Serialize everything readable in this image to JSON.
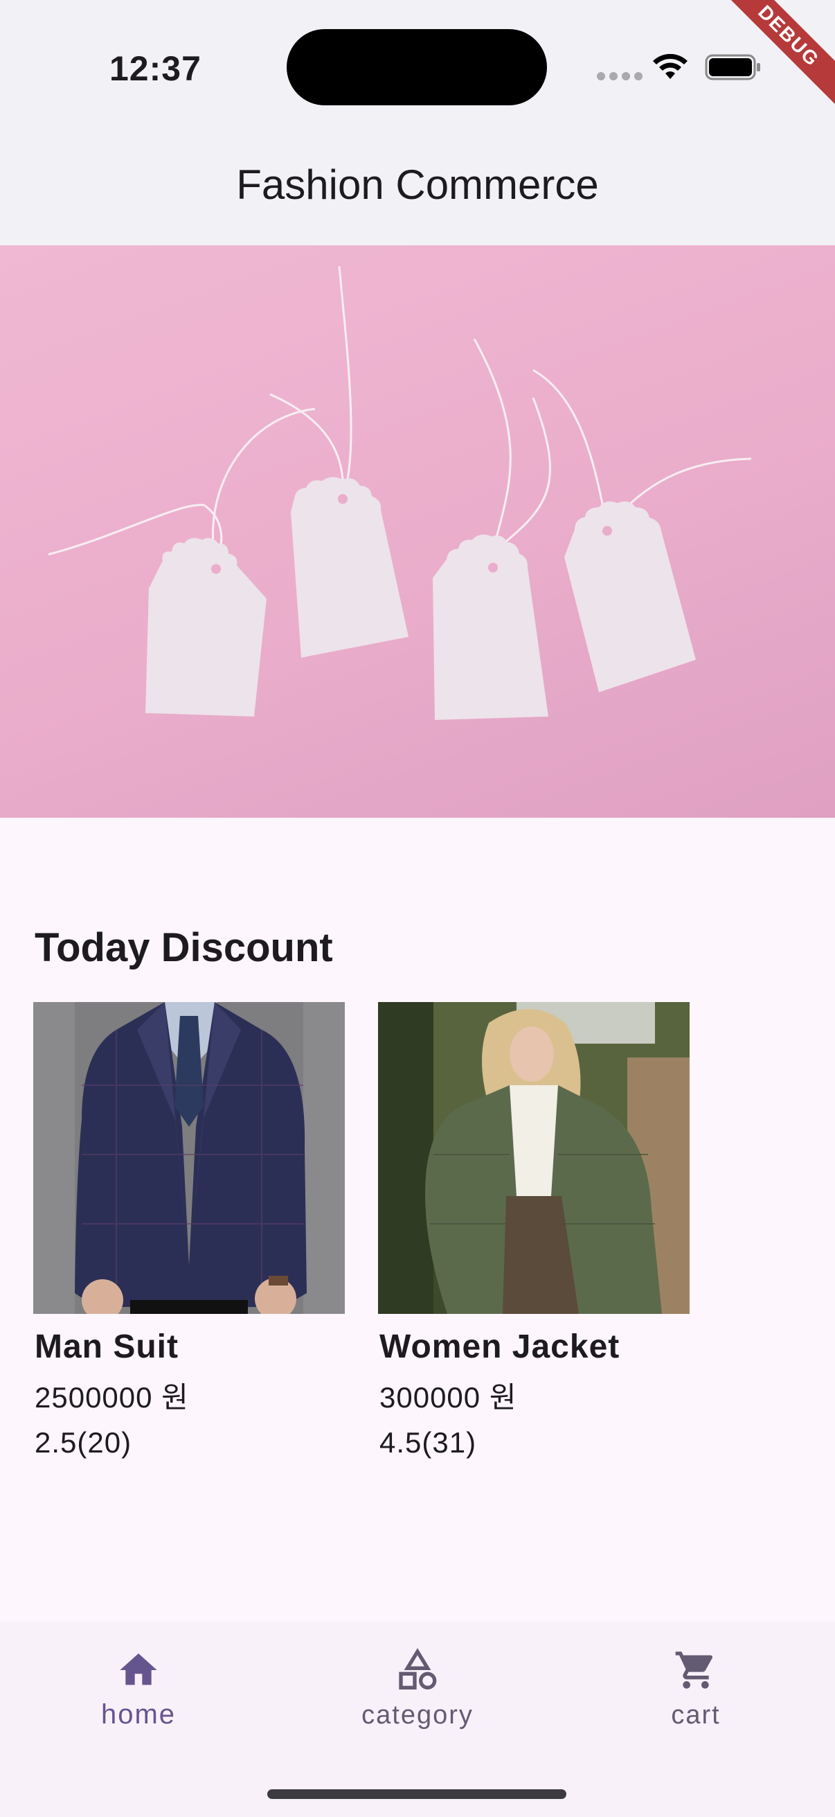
{
  "status_bar": {
    "time": "12:37",
    "debug_label": "DEBUG"
  },
  "app_bar": {
    "title": "Fashion Commerce"
  },
  "banner": {
    "description_icon": "price-tags-banner"
  },
  "today_discount": {
    "title": "Today Discount",
    "products": [
      {
        "name": "Man Suit",
        "price": "2500000 원",
        "rating": "2.5(20)"
      },
      {
        "name": "Women Jacket",
        "price": "300000 원",
        "rating": "4.5(31)"
      }
    ]
  },
  "bottom_nav": {
    "items": [
      {
        "label": "home",
        "icon": "home-icon",
        "active": true
      },
      {
        "label": "category",
        "icon": "category-icon",
        "active": false
      },
      {
        "label": "cart",
        "icon": "cart-icon",
        "active": false
      }
    ]
  },
  "colors": {
    "accent": "#65558f",
    "nav_inactive": "#625b71",
    "background": "#fdf6fd",
    "app_bar": "#f2f1f6",
    "banner_pink": "#eaadcb"
  }
}
